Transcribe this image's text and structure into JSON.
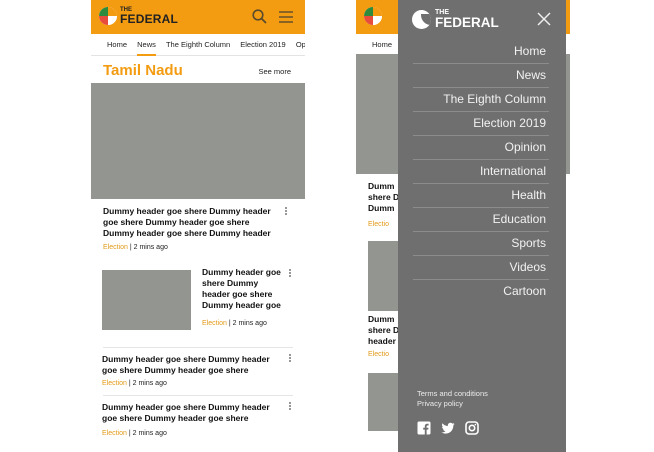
{
  "brand": {
    "the": "THE",
    "name": "FEDERAL"
  },
  "nav_tabs": [
    "Home",
    "News",
    "The Eighth Column",
    "Election 2019",
    "Opin"
  ],
  "section": {
    "title": "Tamil Nadu",
    "see_more": "See more"
  },
  "stories": [
    {
      "headline": "Dummy header goe shere  Dummy header goe shere  Dummy header goe shere Dummy header goe shere  Dummy header",
      "category": "Election",
      "time": "| 2 mins ago"
    },
    {
      "headline": "Dummy header goe shere  Dummy header goe shere Dummy header goe",
      "category": "Election",
      "time": "| 2 mins ago"
    },
    {
      "headline": "Dummy header goe shere  Dummy header goe shere  Dummy header goe shere",
      "category": "Election",
      "time": "| 2 mins ago"
    },
    {
      "headline": "Dummy header goe shere  Dummy header goe shere  Dummy header goe shere",
      "category": "Election",
      "time": "| 2 mins ago"
    }
  ],
  "underlay": {
    "tab": "Home",
    "frag1": [
      "Dumm",
      "shere  D",
      "Dumm"
    ],
    "frag1_meta": "Electio",
    "frag2": [
      "Dumm",
      "shere  D",
      "header"
    ],
    "frag2_meta": "Electio"
  },
  "menu": {
    "brand_the": "THE",
    "brand_name": "FEDERAL",
    "items": [
      "Home",
      "News",
      "The Eighth Column",
      "Election 2019",
      "Opinion",
      "International",
      "Health",
      "Education",
      "Sports",
      "Videos",
      "Cartoon"
    ],
    "terms": "Terms and conditions",
    "privacy": "Privacy policy"
  },
  "colors": {
    "accent": "#f39c12",
    "overlay": "#6f6f6f",
    "placeholder": "#939590"
  }
}
